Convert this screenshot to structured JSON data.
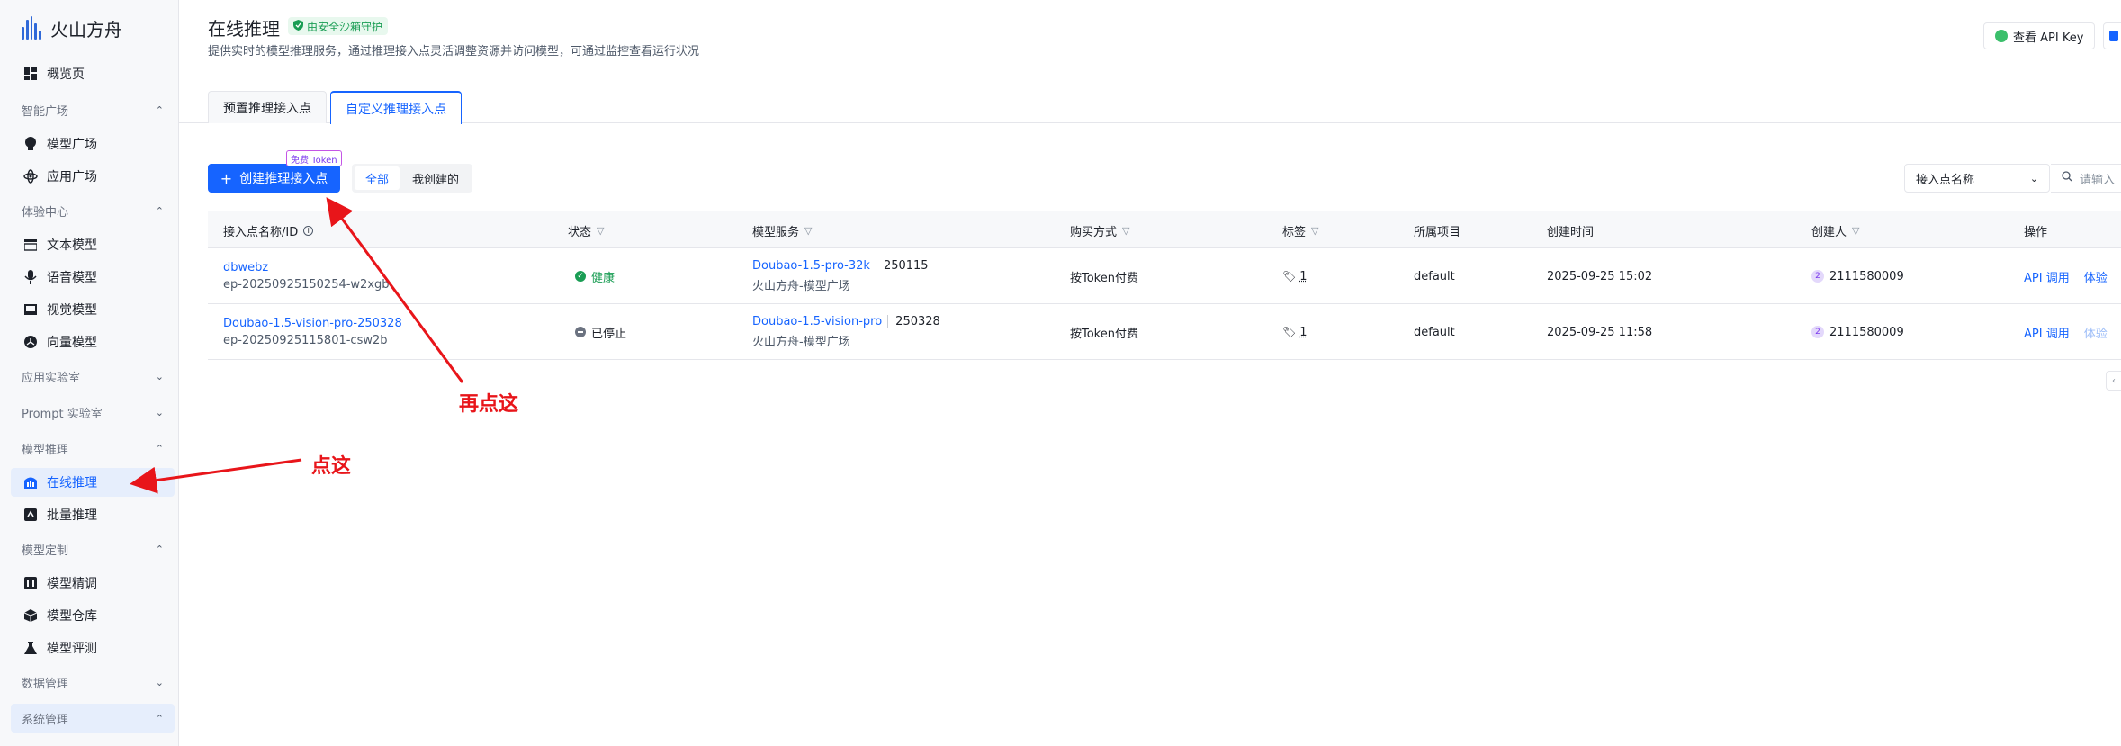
{
  "sidebar": {
    "brand": "火山方舟",
    "items": {
      "overview": "概览页",
      "group_square": "智能广场",
      "model_square": "模型广场",
      "app_square": "应用广场",
      "group_experience": "体验中心",
      "text_model": "文本模型",
      "voice_model": "语音模型",
      "vision_model": "视觉模型",
      "vector_model": "向量模型",
      "group_applab": "应用实验室",
      "group_promptlab": "Prompt 实验室",
      "group_inference": "模型推理",
      "online_inference": "在线推理",
      "batch_inference": "批量推理",
      "group_custom": "模型定制",
      "fine_tune": "模型精调",
      "repository": "模型仓库",
      "evaluation": "模型评测",
      "group_data": "数据管理",
      "group_system": "系统管理"
    }
  },
  "header": {
    "title": "在线推理",
    "badge": "由安全沙箱守护",
    "description": "提供实时的模型推理服务，通过推理接入点灵活调整资源并访问模型，可通过监控查看运行状况",
    "api_key_button": "查看 API Key"
  },
  "tabs": {
    "preset": "预置推理接入点",
    "custom": "自定义推理接入点"
  },
  "toolbar": {
    "create_button": "创建推理接入点",
    "free_tag": "免费 Token",
    "filter_all": "全部",
    "filter_mine": "我创建的",
    "select_value": "接入点名称",
    "search_placeholder": "请输入"
  },
  "table": {
    "headers": {
      "name": "接入点名称/ID",
      "status": "状态",
      "service": "模型服务",
      "purchase": "购买方式",
      "tags": "标签",
      "project": "所属项目",
      "created": "创建时间",
      "creator": "创建人",
      "actions": "操作"
    },
    "rows": [
      {
        "name": "dbwebz",
        "id": "ep-20250925150254-w2xgb",
        "status": "健康",
        "model": "Doubao-1.5-pro-32k",
        "version": "250115",
        "source": "火山方舟-模型广场",
        "purchase": "按Token付费",
        "tags": "1",
        "project": "default",
        "created": "2025-09-25 15:02",
        "avatar": "2",
        "creator": "2111580009",
        "api": "API 调用",
        "try": "体验"
      },
      {
        "name": "Doubao-1.5-vision-pro-250328",
        "id": "ep-20250925115801-csw2b",
        "status": "已停止",
        "model": "Doubao-1.5-vision-pro",
        "version": "250328",
        "source": "火山方舟-模型广场",
        "purchase": "按Token付费",
        "tags": "1",
        "project": "default",
        "created": "2025-09-25 11:58",
        "avatar": "2",
        "creator": "2111580009",
        "api": "API 调用",
        "try": "体验"
      }
    ]
  },
  "annotations": {
    "first": "点这",
    "second": "再点这",
    "color": "#e8151a"
  },
  "colors": {
    "primary": "#1664ff",
    "success": "#1a9d54"
  }
}
